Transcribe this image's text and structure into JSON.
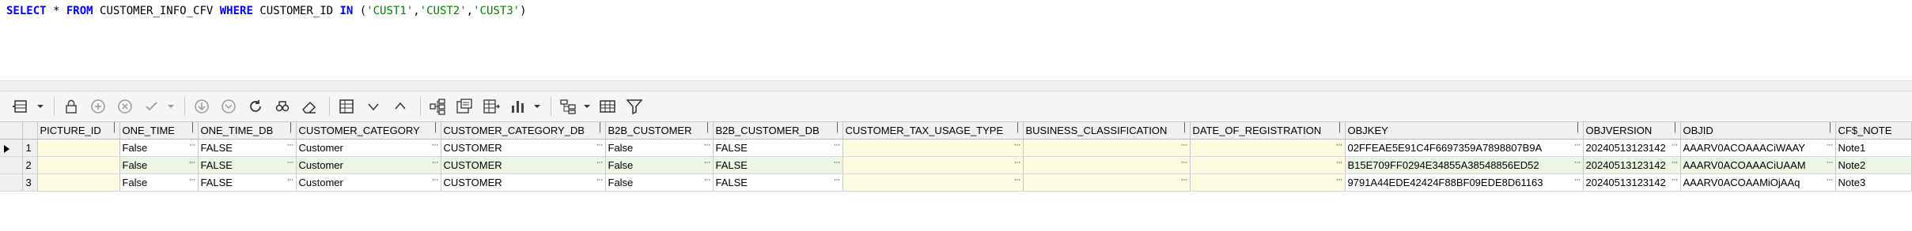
{
  "sql": {
    "kw_select": "SELECT",
    "star": " * ",
    "kw_from": "FROM",
    "table_name": " CUSTOMER_INFO_CFV ",
    "kw_where": "WHERE",
    "column": " CUSTOMER_ID ",
    "kw_in": "IN",
    "open": " (",
    "v1": "'CUST1'",
    "comma1": ",",
    "v2": "'CUST2'",
    "comma2": ",",
    "v3": "'CUST3'",
    "close": ")"
  },
  "toolbar_icons": [
    "record-icon",
    "lock-icon",
    "add-icon",
    "remove-icon",
    "check-icon",
    "down-icon",
    "down2-icon",
    "refresh-icon",
    "search-icon",
    "eraser-icon",
    "grid-icon",
    "filter-down-icon",
    "filter-up-icon",
    "tree-icon",
    "export-icon",
    "table-export-icon",
    "chart-icon",
    "layout-icon",
    "table-icon",
    "filter-icon"
  ],
  "columns": [
    "PICTURE_ID",
    "ONE_TIME",
    "ONE_TIME_DB",
    "CUSTOMER_CATEGORY",
    "CUSTOMER_CATEGORY_DB",
    "B2B_CUSTOMER",
    "B2B_CUSTOMER_DB",
    "CUSTOMER_TAX_USAGE_TYPE",
    "BUSINESS_CLASSIFICATION",
    "DATE_OF_REGISTRATION",
    "OBJKEY",
    "OBJVERSION",
    "OBJID",
    "CF$_NOTE"
  ],
  "rows": [
    {
      "num": "1",
      "cells": [
        "",
        "False",
        "FALSE",
        "Customer",
        "CUSTOMER",
        "False",
        "FALSE",
        "",
        "",
        "",
        "02FFEAE5E91C4F6697359A7898807B9A",
        "20240513123142",
        "AAARV0ACOAAACiWAAY",
        "Note1"
      ]
    },
    {
      "num": "2",
      "cells": [
        "",
        "False",
        "FALSE",
        "Customer",
        "CUSTOMER",
        "False",
        "FALSE",
        "",
        "",
        "",
        "B15E709FF0294E34855A38548856ED52",
        "20240513123142",
        "AAARV0ACOAAACiUAAM",
        "Note2"
      ]
    },
    {
      "num": "3",
      "cells": [
        "",
        "False",
        "FALSE",
        "Customer",
        "CUSTOMER",
        "False",
        "FALSE",
        "",
        "",
        "",
        "9791A44EDE42424F88BF09EDE8D61163",
        "20240513123142",
        "AAARV0ACOAAMiOjAAq",
        "Note3"
      ]
    }
  ],
  "colors": {
    "alt_row": "#ebf6e4",
    "empty_cell": "#fdfbe0",
    "keyword": "#0000ff",
    "string": "#008000"
  }
}
